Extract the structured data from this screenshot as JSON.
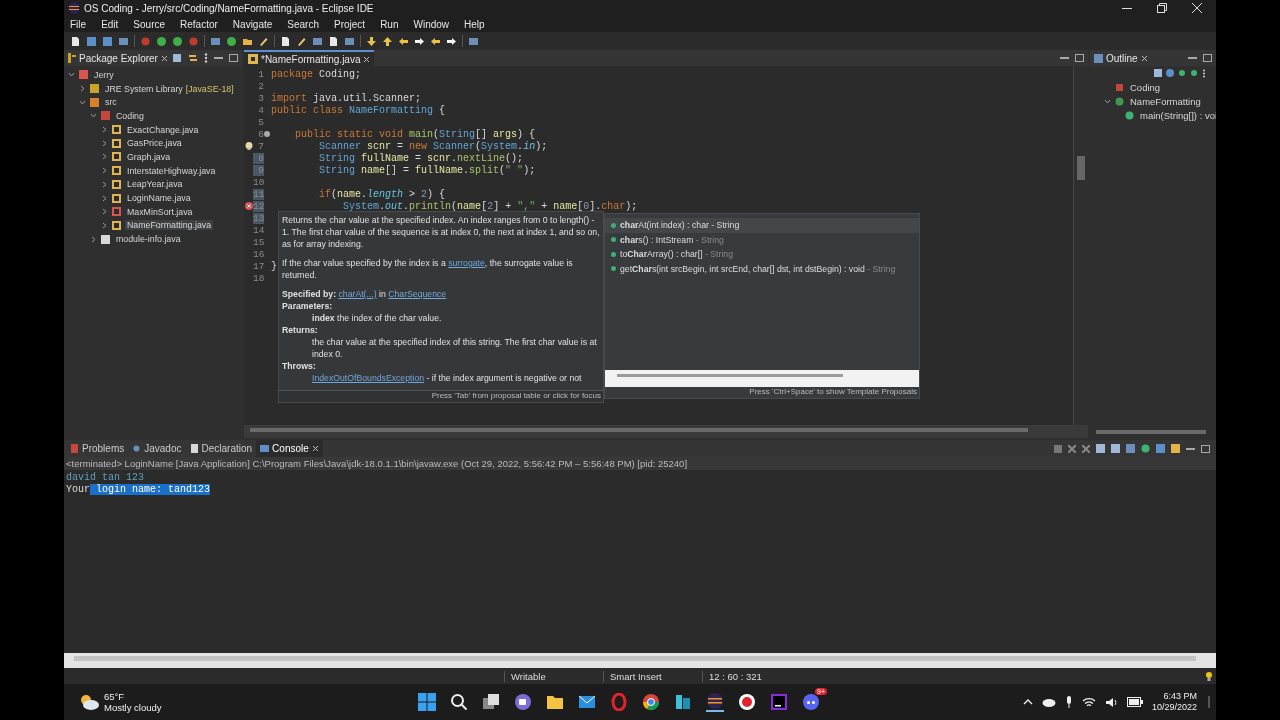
{
  "window": {
    "title": "OS Coding - Jerry/src/Coding/NameFormatting.java - Eclipse IDE"
  },
  "menu": [
    "File",
    "Edit",
    "Source",
    "Refactor",
    "Navigate",
    "Search",
    "Project",
    "Run",
    "Window",
    "Help"
  ],
  "package_explorer": {
    "title": "Package Explorer",
    "tree": [
      {
        "label": "Jerry",
        "kind": "project",
        "expanded": true,
        "selected": false,
        "children": [
          {
            "label": "JRE System Library",
            "decoration": "[JavaSE-18]",
            "kind": "library",
            "expanded": false,
            "selected": false
          },
          {
            "label": "src",
            "kind": "folder",
            "expanded": true,
            "selected": false,
            "children": [
              {
                "label": "Coding",
                "kind": "package",
                "expanded": true,
                "selected": false,
                "children": [
                  {
                    "label": "ExactChange.java",
                    "kind": "java",
                    "expanded": false,
                    "selected": false
                  },
                  {
                    "label": "GasPrice.java",
                    "kind": "java",
                    "expanded": false,
                    "selected": false
                  },
                  {
                    "label": "Graph.java",
                    "kind": "java",
                    "expanded": false,
                    "selected": false
                  },
                  {
                    "label": "InterstateHighway.java",
                    "kind": "java",
                    "expanded": false,
                    "selected": false
                  },
                  {
                    "label": "LeapYear.java",
                    "kind": "java",
                    "expanded": false,
                    "selected": false
                  },
                  {
                    "label": "LoginName.java",
                    "kind": "java",
                    "expanded": false,
                    "selected": false
                  },
                  {
                    "label": "MaxMinSort.java",
                    "kind": "error",
                    "expanded": false,
                    "selected": false
                  },
                  {
                    "label": "NameFormatting.java",
                    "kind": "java",
                    "expanded": false,
                    "selected": true
                  }
                ]
              },
              {
                "label": "module-info.java",
                "kind": "module",
                "expanded": false,
                "selected": false
              }
            ]
          }
        ]
      }
    ]
  },
  "editor": {
    "tab": "*NameFormatting.java",
    "lines": [
      {
        "number": "1",
        "changed": false,
        "tokens": [
          {
            "kind": "kw",
            "text": "package"
          },
          {
            "kind": "plain",
            "text": " Coding;"
          }
        ]
      },
      {
        "number": "2",
        "changed": false
      },
      {
        "number": "3",
        "changed": false,
        "tokens": [
          {
            "kind": "kw",
            "text": "import"
          },
          {
            "kind": "plain",
            "text": " java.util.Scanner;"
          }
        ]
      },
      {
        "number": "4",
        "changed": false,
        "tokens": [
          {
            "kind": "kw",
            "text": "public class "
          },
          {
            "kind": "type",
            "text": "NameFormatting"
          },
          {
            "kind": "plain",
            "text": " {"
          }
        ]
      },
      {
        "number": "5",
        "changed": false
      },
      {
        "number": "6",
        "changed": false,
        "kind": "fold",
        "tokens": [
          {
            "kind": "kw",
            "text": "    public static void "
          },
          {
            "kind": "method",
            "text": "main"
          },
          {
            "kind": "plain",
            "text": "("
          },
          {
            "kind": "type",
            "text": "String"
          },
          {
            "kind": "plain",
            "text": "[] "
          },
          {
            "kind": "var",
            "text": "args"
          },
          {
            "kind": "plain",
            "text": ") {"
          }
        ]
      },
      {
        "number": "7",
        "changed": false,
        "kind": "warning",
        "tokens": [
          {
            "kind": "type",
            "text": "        Scanner "
          },
          {
            "kind": "var",
            "text": "scnr"
          },
          {
            "kind": "plain",
            "text": " = "
          },
          {
            "kind": "kw",
            "text": "new "
          },
          {
            "kind": "type",
            "text": "Scanner"
          },
          {
            "kind": "plain",
            "text": "("
          },
          {
            "kind": "type",
            "text": "System"
          },
          {
            "kind": "plain",
            "text": "."
          },
          {
            "kind": "field",
            "text": "in"
          },
          {
            "kind": "plain",
            "text": ");"
          }
        ]
      },
      {
        "number": "8",
        "changed": true,
        "tokens": [
          {
            "kind": "type",
            "text": "        String "
          },
          {
            "kind": "var",
            "text": "fullName"
          },
          {
            "kind": "plain",
            "text": " = "
          },
          {
            "kind": "var",
            "text": "scnr"
          },
          {
            "kind": "plain",
            "text": "."
          },
          {
            "kind": "method",
            "text": "nextLine"
          },
          {
            "kind": "plain",
            "text": "();"
          }
        ]
      },
      {
        "number": "9",
        "changed": true,
        "tokens": [
          {
            "kind": "type",
            "text": "        String "
          },
          {
            "kind": "var",
            "text": "name"
          },
          {
            "kind": "plain",
            "text": "[] = "
          },
          {
            "kind": "var",
            "text": "fullName"
          },
          {
            "kind": "plain",
            "text": "."
          },
          {
            "kind": "method",
            "text": "split"
          },
          {
            "kind": "plain",
            "text": "("
          },
          {
            "kind": "str",
            "text": "\" \""
          },
          {
            "kind": "plain",
            "text": ");"
          }
        ]
      },
      {
        "number": "10",
        "changed": false
      },
      {
        "number": "11",
        "changed": true,
        "tokens": [
          {
            "kind": "kw",
            "text": "        if"
          },
          {
            "kind": "plain",
            "text": "("
          },
          {
            "kind": "var",
            "text": "name"
          },
          {
            "kind": "plain",
            "text": "."
          },
          {
            "kind": "field",
            "text": "length"
          },
          {
            "kind": "plain",
            "text": " > "
          },
          {
            "kind": "num",
            "text": "2"
          },
          {
            "kind": "plain",
            "text": ") {"
          }
        ]
      },
      {
        "number": "12",
        "changed": true,
        "kind": "error",
        "tokens": [
          {
            "kind": "type",
            "text": "            System"
          },
          {
            "kind": "plain",
            "text": "."
          },
          {
            "kind": "field",
            "text": "out"
          },
          {
            "kind": "plain",
            "text": "."
          },
          {
            "kind": "method",
            "text": "println"
          },
          {
            "kind": "plain",
            "text": "("
          },
          {
            "kind": "var",
            "text": "name"
          },
          {
            "kind": "plain",
            "text": "["
          },
          {
            "kind": "num",
            "text": "2"
          },
          {
            "kind": "plain",
            "text": "] + "
          },
          {
            "kind": "str",
            "text": "\",\""
          },
          {
            "kind": "plain",
            "text": " + "
          },
          {
            "kind": "var",
            "text": "name"
          },
          {
            "kind": "plain",
            "text": "["
          },
          {
            "kind": "num",
            "text": "0"
          },
          {
            "kind": "plain",
            "text": "]."
          },
          {
            "kind": "kw",
            "text": "char"
          },
          {
            "kind": "plain",
            "text": ");"
          }
        ]
      },
      {
        "number": "13",
        "changed": true
      },
      {
        "number": "14",
        "changed": false
      },
      {
        "number": "15",
        "changed": false
      },
      {
        "number": "16",
        "changed": false
      },
      {
        "number": "17",
        "changed": false,
        "tokens": [
          {
            "kind": "plain",
            "text": "}"
          }
        ]
      },
      {
        "number": "18",
        "changed": false
      }
    ]
  },
  "javadoc_popup": {
    "summary": "Returns the char value at the specified index. An index ranges from 0 to length() - 1. The first char value of the sequence is at index 0, the next at index 1, and so on, as for array indexing.",
    "surrogate_note": {
      "before": "If the char value specified by the index is a ",
      "link": "surrogate",
      "after": ", the surrogate value is returned."
    },
    "specified_by": {
      "label": "Specified by:",
      "link": "charAt(...)",
      "middle": "in",
      "link2": "CharSequence"
    },
    "parameters": {
      "heading": "Parameters:",
      "text": "**index** the index of the char value."
    },
    "returns": {
      "heading": "Returns:",
      "text": "the char value at the specified index of this string. The first char value is at index 0."
    },
    "throws": {
      "heading": "Throws:",
      "link": "IndexOutOfBoundsException",
      "text": "- if the index argument is negative or not"
    },
    "footer": "Press 'Tab' from proposal table or click for focus"
  },
  "proposals": {
    "items": [
      {
        "label": "**char**At(int index) : char",
        "owner": "- String",
        "selected": true
      },
      {
        "label": "**char**s() : IntStream",
        "owner": "- String",
        "selected": false
      },
      {
        "label": "to**Char**Array() : char[]",
        "owner": "- String",
        "selected": false
      },
      {
        "label": "get**Char**s(int srcBegin, int srcEnd, char[] dst, int dstBegin) : void",
        "owner": "- String",
        "selected": false
      }
    ],
    "footer": "Press 'Ctrl+Space' to show Template Proposals"
  },
  "outline": {
    "title": "Outline",
    "tree": [
      {
        "label": "Coding",
        "kind": "package",
        "selected": false
      },
      {
        "label": "NameFormatting",
        "kind": "class",
        "expanded": true,
        "selected": false,
        "children": [
          {
            "label": "main(String[]) : voi",
            "kind": "method",
            "selected": false
          }
        ]
      }
    ]
  },
  "bottom_panel": {
    "tabs": [
      {
        "label": "Problems",
        "kind": "problems",
        "selected": false
      },
      {
        "label": "Javadoc",
        "kind": "javadoc",
        "selected": false
      },
      {
        "label": "Declaration",
        "kind": "declaration",
        "selected": false
      },
      {
        "label": "Console",
        "kind": "console",
        "selected": true
      }
    ],
    "info": "<terminated> LoginName [Java Application] C:\\Program Files\\Java\\jdk-18.0.1.1\\bin\\javaw.exe  (Oct 29, 2022, 5:56:42 PM – 5:56:48 PM) [pid: 25240]",
    "console": [
      {
        "kind": "input",
        "segments": [
          {
            "text": "david tan 123",
            "selected": false
          }
        ]
      },
      {
        "kind": "output",
        "segments": [
          {
            "text": "Your",
            "selected": false
          },
          {
            "text": " login name: tand123",
            "selected": true
          }
        ]
      }
    ]
  },
  "status_bar": [
    "Writable",
    "Smart Insert",
    "12 : 60 : 321"
  ],
  "taskbar": {
    "weather": {
      "temperature": "65°F",
      "condition": "Mostly cloudy"
    },
    "discord_badge": "9+",
    "time": "6:43 PM",
    "date": "10/29/2022"
  }
}
